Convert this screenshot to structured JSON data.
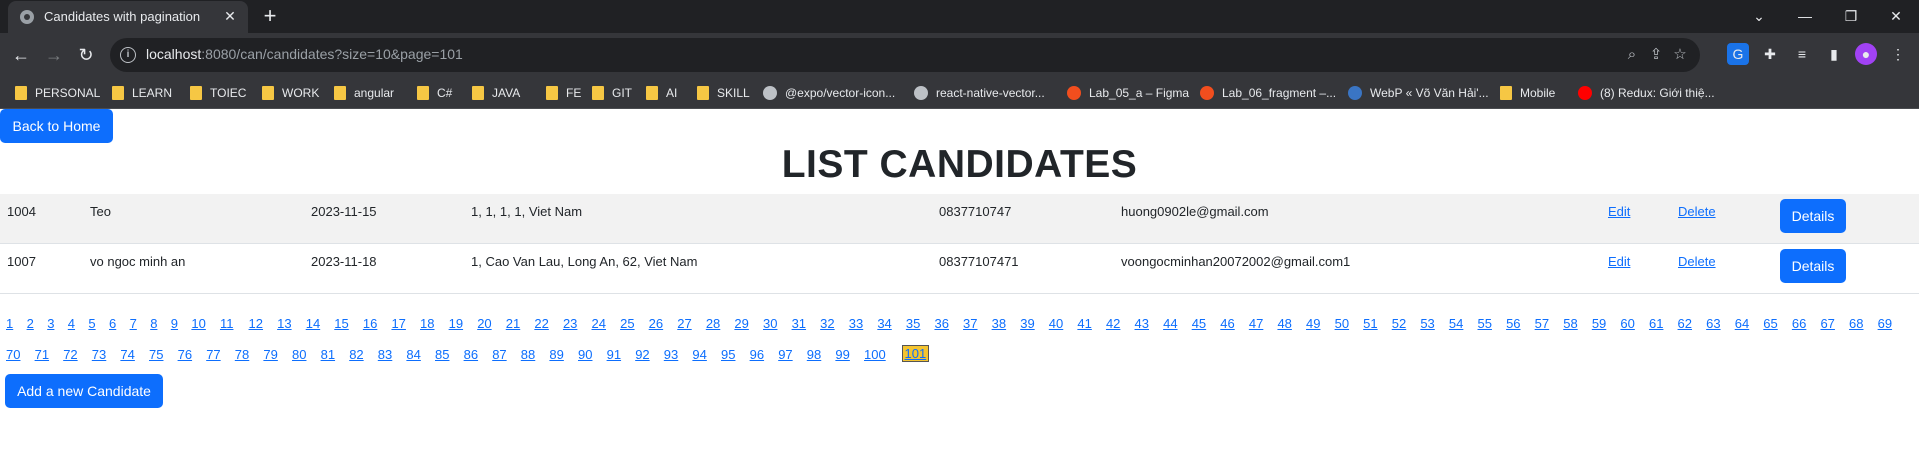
{
  "browser": {
    "tab_title": "Candidates with pagination",
    "url_host": "localhost",
    "url_rest": ":8080/can/candidates?size=10&page=101",
    "bookmarks": [
      {
        "label": "PERSONAL",
        "kind": "folder"
      },
      {
        "label": "LEARN",
        "kind": "folder"
      },
      {
        "label": "TOIEC",
        "kind": "folder"
      },
      {
        "label": "WORK",
        "kind": "folder"
      },
      {
        "label": "angular",
        "kind": "folder"
      },
      {
        "label": "C#",
        "kind": "folder"
      },
      {
        "label": "JAVA",
        "kind": "folder"
      },
      {
        "label": "FE",
        "kind": "folder"
      },
      {
        "label": "GIT",
        "kind": "folder"
      },
      {
        "label": "AI",
        "kind": "folder"
      },
      {
        "label": "SKILL",
        "kind": "folder"
      },
      {
        "label": "@expo/vector-icon...",
        "kind": "site",
        "color": "#bdc1c6"
      },
      {
        "label": "react-native-vector...",
        "kind": "site",
        "color": "#bdc1c6"
      },
      {
        "label": "Lab_05_a – Figma",
        "kind": "site",
        "color": "#f24e1e"
      },
      {
        "label": "Lab_06_fragment –...",
        "kind": "site",
        "color": "#f24e1e"
      },
      {
        "label": "WebP « Võ Văn Hải'...",
        "kind": "site",
        "color": "#3a75c4"
      },
      {
        "label": "Mobile",
        "kind": "folder"
      },
      {
        "label": "(8) Redux: Giới thiệ...",
        "kind": "site",
        "color": "#ff0000"
      }
    ]
  },
  "page": {
    "back_label": "Back to Home",
    "title": "LIST CANDIDATES",
    "edit_label": "Edit",
    "delete_label": "Delete",
    "details_label": "Details",
    "add_label": "Add a new Candidate",
    "candidates": [
      {
        "id": "1004",
        "name": "Teo",
        "dob": "2023-11-15",
        "address": "1, 1, 1, 1, Viet Nam",
        "phone": "0837710747",
        "email": "huong0902le@gmail.com"
      },
      {
        "id": "1007",
        "name": "vo ngoc minh an",
        "dob": "2023-11-18",
        "address": "1, Cao Van Lau, Long An, 62, Viet Nam",
        "phone": "08377107471",
        "email": "voongocminhan20072002@gmail.com1"
      }
    ],
    "pagination": {
      "total_pages": 101,
      "current_page": 101
    }
  }
}
